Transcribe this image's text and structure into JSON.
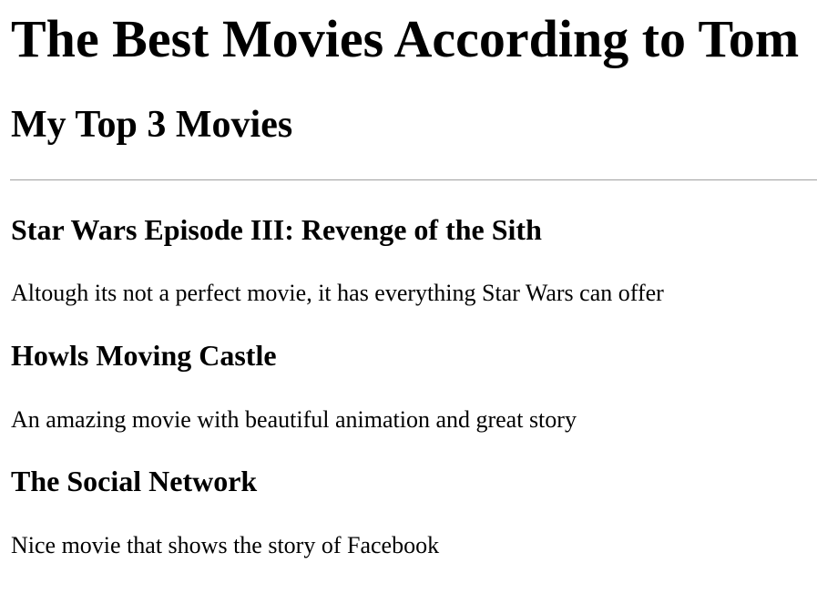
{
  "page": {
    "title": "The Best Movies According to Tom",
    "section_title": "My Top 3 Movies"
  },
  "movies": [
    {
      "title": "Star Wars Episode III: Revenge of the Sith",
      "description": "Altough its not a perfect movie, it has everything Star Wars can offer"
    },
    {
      "title": "Howls Moving Castle",
      "description": "An amazing movie with beautiful animation and great story"
    },
    {
      "title": "The Social Network",
      "description": "Nice movie that shows the story of Facebook"
    }
  ]
}
